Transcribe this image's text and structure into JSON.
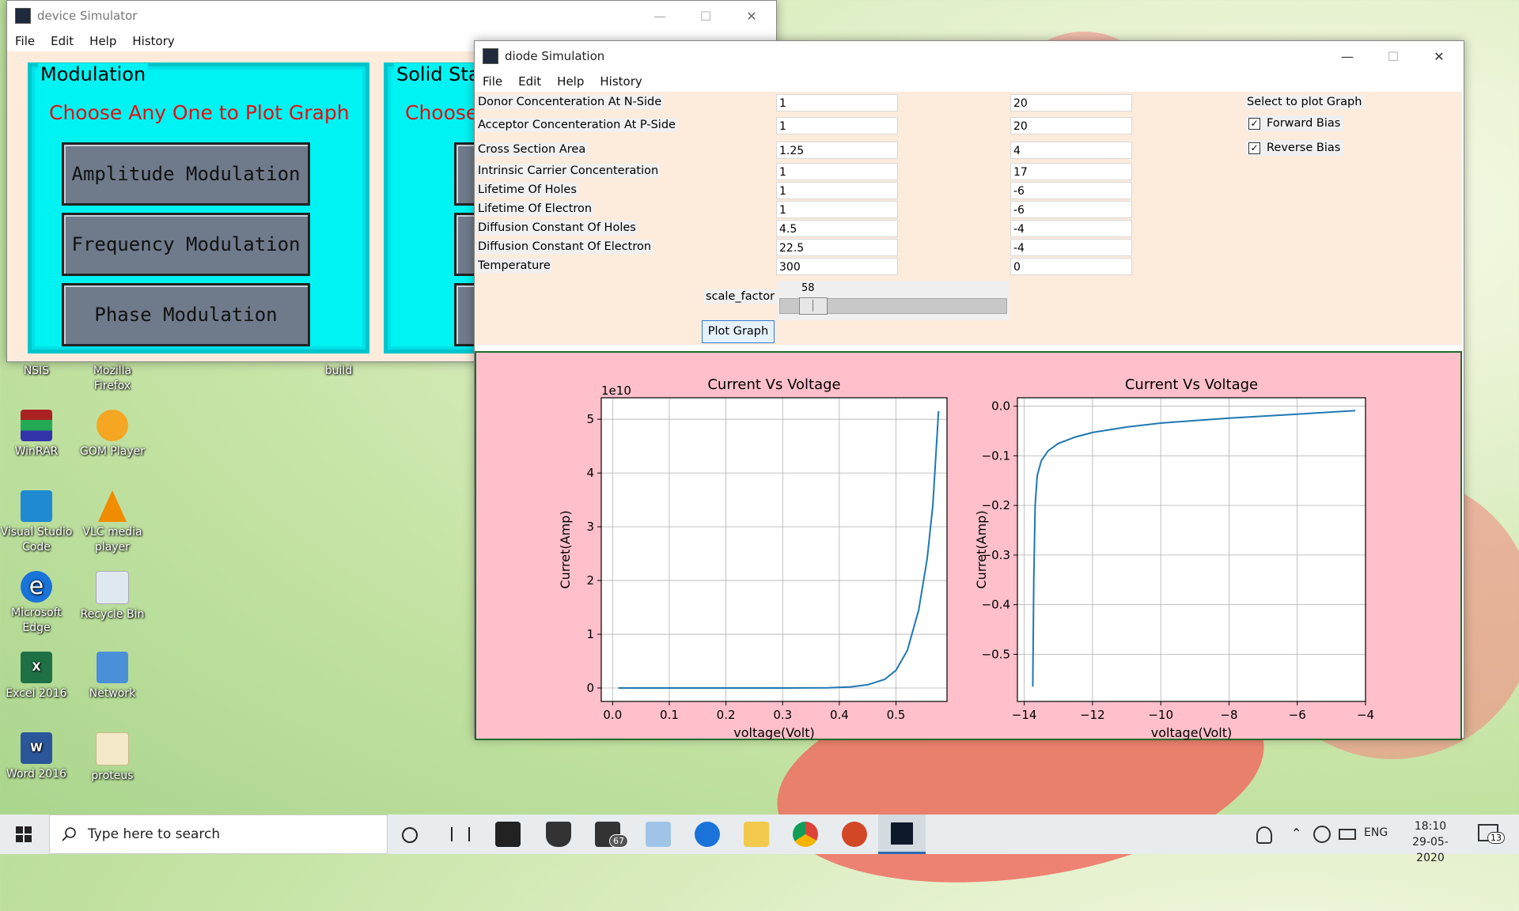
{
  "desktop": {
    "icons": [
      {
        "label": "NSIS"
      },
      {
        "label": "Mozilla Firefox"
      },
      {
        "label": "build"
      },
      {
        "label": "WinRAR"
      },
      {
        "label": "GOM Player"
      },
      {
        "label": "Visual Studio Code"
      },
      {
        "label": "VLC media player"
      },
      {
        "label": "Microsoft Edge"
      },
      {
        "label": "Recycle Bin"
      },
      {
        "label": "Excel 2016"
      },
      {
        "label": "Network"
      },
      {
        "label": "Word 2016"
      },
      {
        "label": "proteus"
      }
    ]
  },
  "device_window": {
    "title": "device Simulator",
    "menu": [
      "File",
      "Edit",
      "Help",
      "History"
    ],
    "modulation": {
      "title": "Modulation",
      "subtitle": "Choose Any One to Plot Graph",
      "buttons": [
        "Amplitude Modulation",
        "Frequency Modulation",
        "Phase Modulation"
      ]
    },
    "solid_state": {
      "title": "Solid Sta",
      "subtitle": "Choose"
    }
  },
  "diode_window": {
    "title": "diode Simulation",
    "menu": [
      "File",
      "Edit",
      "Help",
      "History"
    ],
    "params": [
      {
        "label": "Donor Concenteration At N-Side",
        "value": "1",
        "exponent": "20"
      },
      {
        "label": "Acceptor Concenteration At P-Side",
        "value": "1",
        "exponent": "20"
      },
      {
        "label": "Cross Section Area",
        "value": "1.25",
        "exponent": "4"
      },
      {
        "label": "Intrinsic Carrier Concenteration",
        "value": "1",
        "exponent": "17"
      },
      {
        "label": "Lifetime Of Holes",
        "value": "1",
        "exponent": "-6"
      },
      {
        "label": "Lifetime Of Electron",
        "value": "1",
        "exponent": "-6"
      },
      {
        "label": "Diffusion Constant Of Holes",
        "value": "4.5",
        "exponent": "-4"
      },
      {
        "label": "Diffusion Constant Of Electron",
        "value": "22.5",
        "exponent": "-4"
      },
      {
        "label": "Temperature",
        "value": "300",
        "exponent": "0"
      }
    ],
    "plot_select": {
      "title": "Select to plot Graph",
      "forward": {
        "label": "Forward Bias",
        "checked": true
      },
      "reverse": {
        "label": "Reverse Bias",
        "checked": true
      }
    },
    "slider": {
      "label": "scale_factor :",
      "value": "58",
      "fraction": 0.1
    },
    "plot_button": "Plot Graph"
  },
  "chart_data": [
    {
      "type": "line",
      "title": "Current Vs Voltage",
      "xlabel": "voltage(Volt)",
      "ylabel": "Curret(Amp)",
      "y_offset_label": "1e10",
      "xlim": [
        -0.02,
        0.59
      ],
      "ylim": [
        -0.25,
        5.4
      ],
      "xticks": [
        "0.0",
        "0.1",
        "0.2",
        "0.3",
        "0.4",
        "0.5"
      ],
      "yticks": [
        "0",
        "1",
        "2",
        "3",
        "4",
        "5"
      ],
      "grid": true,
      "series": [
        {
          "color": "#1f77b4",
          "x": [
            0.01,
            0.1,
            0.2,
            0.3,
            0.38,
            0.42,
            0.45,
            0.48,
            0.5,
            0.52,
            0.54,
            0.555,
            0.565,
            0.575
          ],
          "y": [
            0,
            0,
            0,
            0,
            0.005,
            0.02,
            0.06,
            0.16,
            0.33,
            0.7,
            1.45,
            2.4,
            3.4,
            5.15
          ]
        }
      ]
    },
    {
      "type": "line",
      "title": "Current Vs Voltage",
      "xlabel": "voltage(Volt)",
      "ylabel": "Curret(Amp)",
      "xlim": [
        -14.2,
        -4.0
      ],
      "ylim": [
        -0.595,
        0.017
      ],
      "xticks": [
        "−14",
        "−12",
        "−10",
        "−8",
        "−6",
        "−4"
      ],
      "yticks": [
        "0.0",
        "−0.1",
        "−0.2",
        "−0.3",
        "−0.4",
        "−0.5"
      ],
      "grid": true,
      "series": [
        {
          "color": "#1f77b4",
          "x": [
            -13.75,
            -13.72,
            -13.68,
            -13.62,
            -13.5,
            -13.3,
            -13.0,
            -12.5,
            -12.0,
            -11.0,
            -10.0,
            -8.0,
            -6.0,
            -4.3
          ],
          "y": [
            -0.565,
            -0.35,
            -0.2,
            -0.14,
            -0.11,
            -0.09,
            -0.075,
            -0.062,
            -0.053,
            -0.042,
            -0.034,
            -0.024,
            -0.016,
            -0.009
          ]
        }
      ]
    }
  ],
  "taskbar": {
    "search_placeholder": "Type here to search",
    "mail_badge": "67",
    "language": "ENG",
    "time": "18:10",
    "date": "29-05-2020",
    "notification_count": "13"
  }
}
